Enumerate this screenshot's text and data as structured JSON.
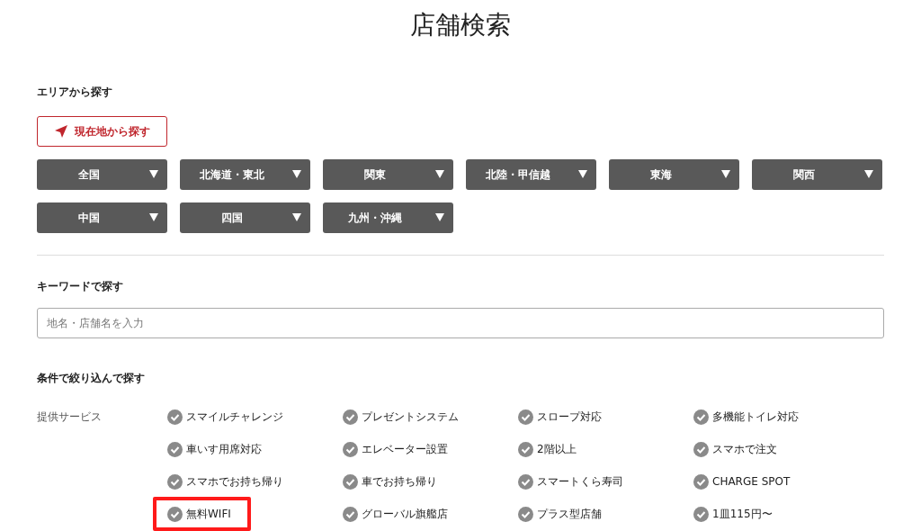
{
  "page_title": "店舗検索",
  "area": {
    "heading": "エリアから探す",
    "locate_button": "現在地から探す",
    "regions": [
      {
        "label": "全国",
        "expanded": false
      },
      {
        "label": "北海道・東北",
        "expanded": false
      },
      {
        "label": "関東",
        "expanded": false
      },
      {
        "label": "北陸・甲信越",
        "expanded": false
      },
      {
        "label": "東海",
        "expanded": false
      },
      {
        "label": "関西",
        "expanded": false
      },
      {
        "label": "中国",
        "expanded": false
      },
      {
        "label": "四国",
        "expanded": false
      },
      {
        "label": "九州・沖縄",
        "expanded": false
      }
    ]
  },
  "keyword": {
    "heading": "キーワードで探す",
    "placeholder": "地名・店舗名を入力"
  },
  "conditions": {
    "heading": "条件で絞り込んで探す",
    "group_label": "提供サービス",
    "services": [
      {
        "label": "スマイルチャレンジ",
        "checked": false,
        "highlighted": false
      },
      {
        "label": "プレゼントシステム",
        "checked": false,
        "highlighted": false
      },
      {
        "label": "スロープ対応",
        "checked": false,
        "highlighted": false
      },
      {
        "label": "多機能トイレ対応",
        "checked": false,
        "highlighted": false
      },
      {
        "label": "車いす用席対応",
        "checked": false,
        "highlighted": false
      },
      {
        "label": "エレベーター設置",
        "checked": false,
        "highlighted": false
      },
      {
        "label": "2階以上",
        "checked": false,
        "highlighted": false
      },
      {
        "label": "スマホで注文",
        "checked": false,
        "highlighted": false
      },
      {
        "label": "スマホでお持ち帰り",
        "checked": false,
        "highlighted": false
      },
      {
        "label": "車でお持ち帰り",
        "checked": false,
        "highlighted": false
      },
      {
        "label": "スマートくら寿司",
        "checked": false,
        "highlighted": false
      },
      {
        "label": "CHARGE SPOT",
        "checked": false,
        "highlighted": false
      },
      {
        "label": "無料WIFI",
        "checked": false,
        "highlighted": true
      },
      {
        "label": "グローバル旗艦店",
        "checked": false,
        "highlighted": false
      },
      {
        "label": "プラス型店舗",
        "checked": false,
        "highlighted": false
      },
      {
        "label": "1皿115円〜",
        "checked": false,
        "highlighted": false
      }
    ]
  }
}
